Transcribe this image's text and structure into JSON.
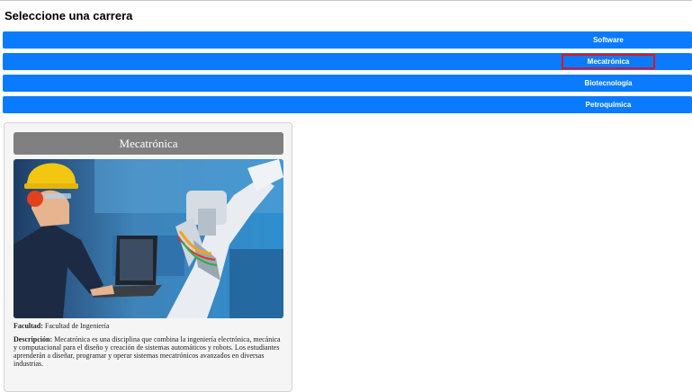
{
  "page": {
    "title": "Seleccione una carrera"
  },
  "careers": [
    {
      "label": "Software"
    },
    {
      "label": "Mecatrónica"
    },
    {
      "label": "Biotecnología"
    },
    {
      "label": "Petroquímica"
    }
  ],
  "selected_career": "Mecatrónica",
  "colors": {
    "button": "#0a7bff",
    "selection_outline": "#e0141e",
    "card_header": "#808080"
  },
  "card": {
    "title": "Mecatrónica",
    "image_alt": "engineer-with-laptop-and-industrial-robot",
    "faculty_label": "Facultad:",
    "faculty_value": "Facultad de Ingeniería",
    "description_label": "Descripción:",
    "description_value": "Mecatrónica es una disciplina que combina la ingeniería electrónica, mecánica y computacional para el diseño y creación de sistemas automáticos y robots. Los estudiantes aprenderán a diseñar, programar y operar sistemas mecatrónicos avanzados en diversas industrias."
  }
}
